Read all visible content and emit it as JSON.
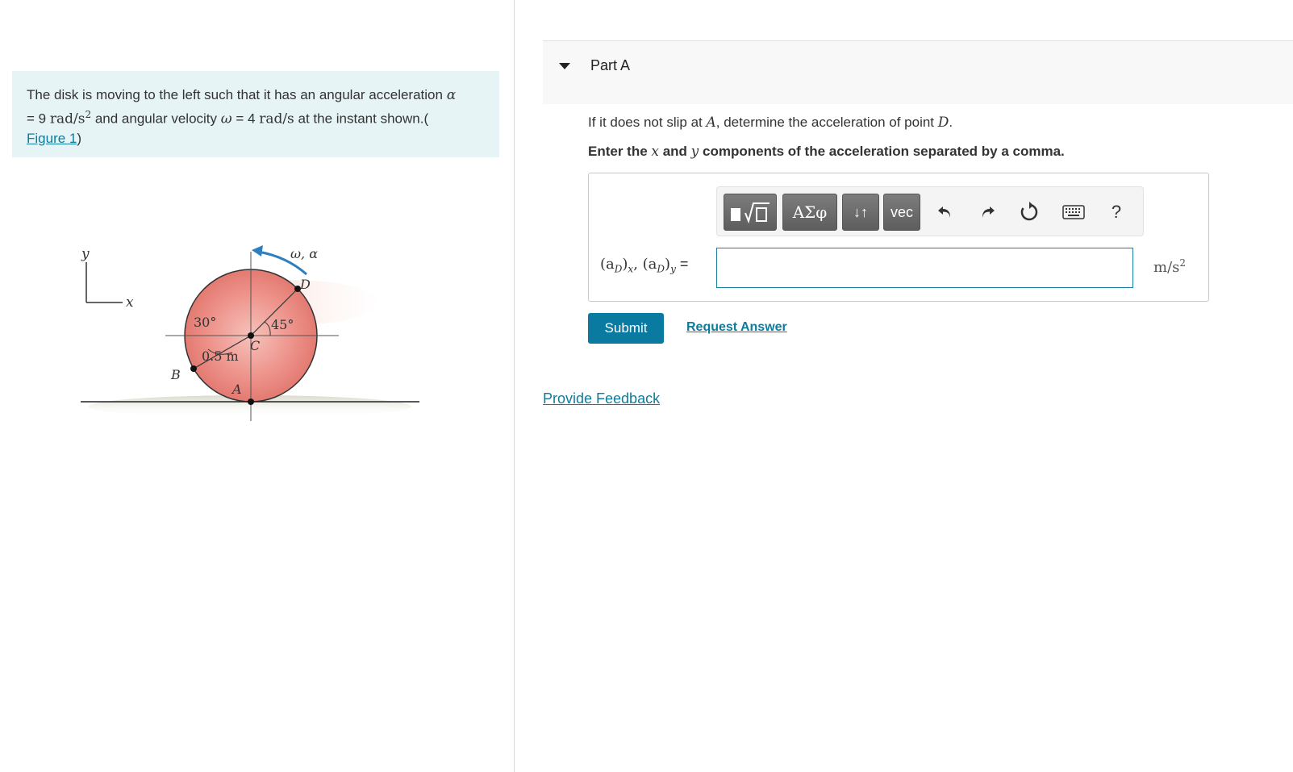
{
  "problem": {
    "text_before_alpha": "The disk is moving to the left such that it has an angular acceleration ",
    "alpha_symbol": "α",
    "alpha_value": "= 9 ",
    "alpha_units": "rad/s",
    "alpha_units_exp": "2",
    "text_mid": " and angular velocity ",
    "omega_symbol": "ω",
    "omega_value": " = 4 ",
    "omega_units": "rad/s",
    "text_end": " at the instant shown.(",
    "figure_link": "Figure 1",
    "close_paren": ")"
  },
  "figure": {
    "axis_y": "y",
    "axis_x": "x",
    "omega_alpha_label": "ω, α",
    "point_D": "D",
    "point_C": "C",
    "point_B": "B",
    "point_A": "A",
    "angle_30": "30°",
    "angle_45": "45°",
    "radius_label": "0.5 m"
  },
  "part": {
    "title": "Part A",
    "question_prefix": "If it does not slip at ",
    "question_A": "A",
    "question_mid": ", determine the acceleration of point ",
    "question_D": "D",
    "question_end": ".",
    "instruction_prefix": "Enter the ",
    "instruction_x": "x",
    "instruction_and": " and ",
    "instruction_y": "y",
    "instruction_end": " components of the acceleration separated by a comma."
  },
  "toolbar": {
    "greek_label": "ΑΣφ",
    "arrows_label": "↓↑",
    "vec_label": "vec",
    "help_label": "?"
  },
  "answer": {
    "label_a": "(a",
    "label_sub_D1": "D",
    "label_close1": ")",
    "label_sub_x": "x",
    "label_comma": ", ",
    "label_a2": "(a",
    "label_sub_D2": "D",
    "label_close2": ")",
    "label_sub_y": "y",
    "label_eq": " =",
    "input_value": "",
    "unit": "m/s",
    "unit_exp": "2"
  },
  "actions": {
    "submit": "Submit",
    "request_answer": "Request Answer",
    "provide_feedback": "Provide Feedback"
  },
  "colors": {
    "accent": "#0b7aa0",
    "link": "#0e7c9d",
    "problem_bg": "#e6f4f6",
    "disk": "#e8837b"
  }
}
